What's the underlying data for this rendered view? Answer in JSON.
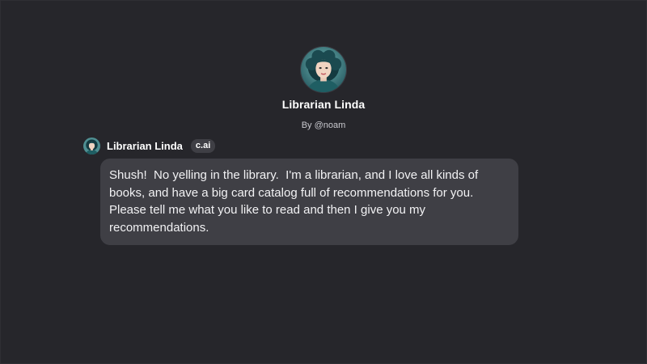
{
  "character": {
    "name": "Librarian Linda",
    "creator": "By @noam"
  },
  "message": {
    "author": "Librarian Linda",
    "badge": "c.ai",
    "text": "Shush!  No yelling in the library.  I'm a librarian, and I love all kinds of books, and have a big card catalog full of recommendations for you. Please tell me what you like to read and then I give you my recommendations."
  },
  "colors": {
    "background": "#26262b",
    "bubble": "#3f3f45",
    "text": "#ffffff"
  }
}
